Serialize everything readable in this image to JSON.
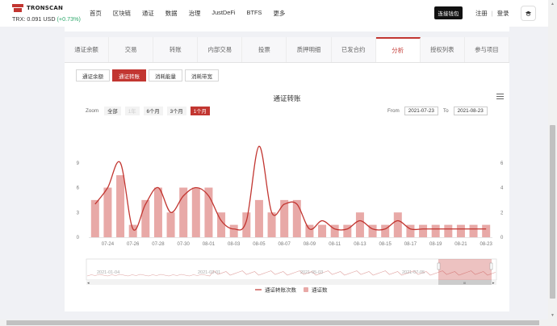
{
  "header": {
    "logo_text": "TRONSCAN",
    "price_label": "TRX: 0.091 USD",
    "price_change": "(+0.73%)",
    "nav": [
      "首页",
      "区块链",
      "通证",
      "数据",
      "治理",
      "JustDeFi",
      "BTFS",
      "更多"
    ],
    "connect_wallet": "连接钱包",
    "register": "注册",
    "login": "登录"
  },
  "tabs": [
    "通证余额",
    "交易",
    "转账",
    "内部交易",
    "投票",
    "质押明细",
    "已发合约",
    "分析",
    "授权列表",
    "参与项目"
  ],
  "active_tab": 7,
  "subtabs": [
    "通证余额",
    "通证转账",
    "消耗能量",
    "消耗带宽"
  ],
  "active_subtab": 1,
  "chart_ui": {
    "zoom_label": "Zoom",
    "zoom_buttons": [
      "全部",
      "1年",
      "6个月",
      "3个月",
      "1个月"
    ],
    "zoom_active": 4,
    "zoom_disabled": 1,
    "from_label": "From",
    "from_value": "2021-07-23",
    "to_label": "To",
    "to_value": "2021-08-23",
    "navigator_labels": [
      "2021-01-04",
      "2021-03-01",
      "2021-05-03",
      "2021-07-05"
    ],
    "navigator_bar_mark": "III"
  },
  "chart_data": {
    "type": "bar",
    "title": "通证转账",
    "x": [
      "07-23",
      "07-24",
      "07-25",
      "07-26",
      "07-27",
      "07-28",
      "07-29",
      "07-30",
      "07-31",
      "08-01",
      "08-02",
      "08-03",
      "08-04",
      "08-05",
      "08-06",
      "08-07",
      "08-08",
      "08-09",
      "08-10",
      "08-11",
      "08-12",
      "08-13",
      "08-14",
      "08-15",
      "08-16",
      "08-17",
      "08-18",
      "08-19",
      "08-20",
      "08-21",
      "08-22",
      "08-23"
    ],
    "x_tick_labels": [
      "07-24",
      "07-26",
      "07-28",
      "07-30",
      "08-01",
      "08-03",
      "08-05",
      "08-07",
      "08-09",
      "08-11",
      "08-13",
      "08-15",
      "08-17",
      "08-19",
      "08-21",
      "08-23"
    ],
    "series": [
      {
        "name": "通证数",
        "type": "bar",
        "axis": "right",
        "color": "#e8a9a7",
        "values": [
          3,
          4,
          5,
          1,
          3,
          4,
          2,
          4,
          4,
          4,
          2,
          1,
          2,
          3,
          2,
          3,
          3,
          1,
          1,
          1,
          1,
          2,
          1,
          1,
          2,
          1,
          1,
          1,
          1,
          1,
          1,
          1
        ]
      },
      {
        "name": "通证转账次数",
        "type": "line",
        "axis": "left",
        "color": "#c23631",
        "values": [
          4,
          6,
          9,
          1,
          4,
          6,
          3,
          5,
          6,
          5,
          2,
          1,
          2,
          11,
          3,
          4,
          4,
          1,
          2,
          1,
          1,
          2,
          1,
          1,
          2,
          1,
          1,
          1,
          1,
          1,
          1,
          1
        ]
      }
    ],
    "y_left": {
      "ticks": [
        0,
        3,
        6,
        9
      ],
      "max": 12
    },
    "y_right": {
      "ticks": [
        0,
        2,
        4,
        6
      ],
      "max": 8
    },
    "grid": false,
    "legend_position": "bottom"
  }
}
